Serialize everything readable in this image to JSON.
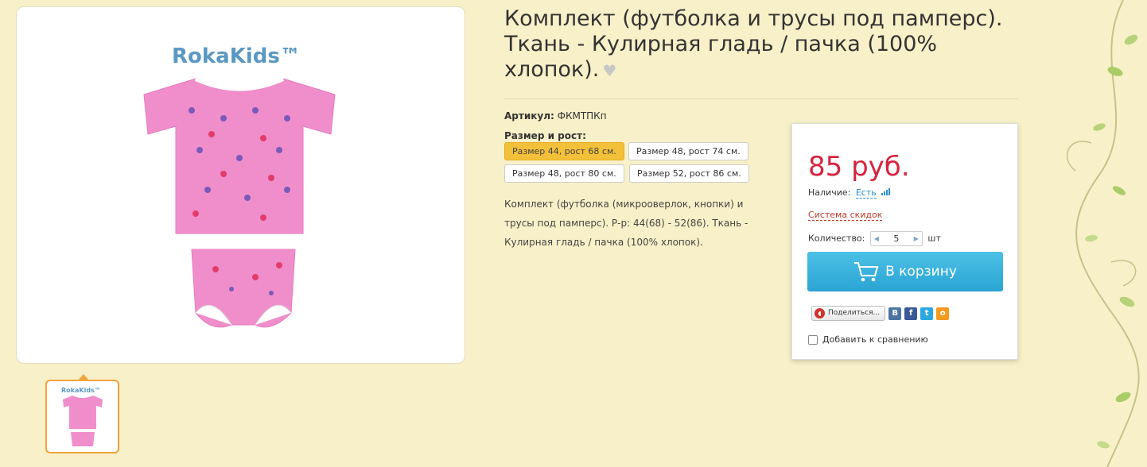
{
  "product": {
    "title": "Комплект (футболка и трусы под памперс). Ткань - Кулирная гладь / пачка (100% хлопок).",
    "sku_label": "Артикул:",
    "sku_value": "ФКМТПКп",
    "size_label": "Размер и рост:",
    "sizes": [
      {
        "label": "Размер 44, рост 68 см.",
        "selected": true
      },
      {
        "label": "Размер 48, рост 74 см.",
        "selected": false
      },
      {
        "label": "Размер 48, рост 80 см.",
        "selected": false
      },
      {
        "label": "Размер 52, рост 86 см.",
        "selected": false
      }
    ],
    "description": "Комплект (футболка (микрооверлок, кнопки) и трусы под памперс). Р-р: 44(68) - 52(86). Ткань - Кулирная гладь / пачка (100% хлопок).",
    "brand_logo": "RokaKids™"
  },
  "buy_box": {
    "price": "85 руб.",
    "availability_label": "Наличие:",
    "availability_value": "Есть",
    "discount_link": "Система скидок",
    "quantity_label": "Количество:",
    "quantity_value": "5",
    "quantity_unit": "шт",
    "cart_button": "В корзину",
    "share_button": "Поделиться...",
    "compare_label": "Добавить к сравнению"
  },
  "colors": {
    "price": "#d6243f",
    "cart_button": "#2aa4d4",
    "selected_size": "#f3c03a",
    "background": "#f8f0c8"
  }
}
